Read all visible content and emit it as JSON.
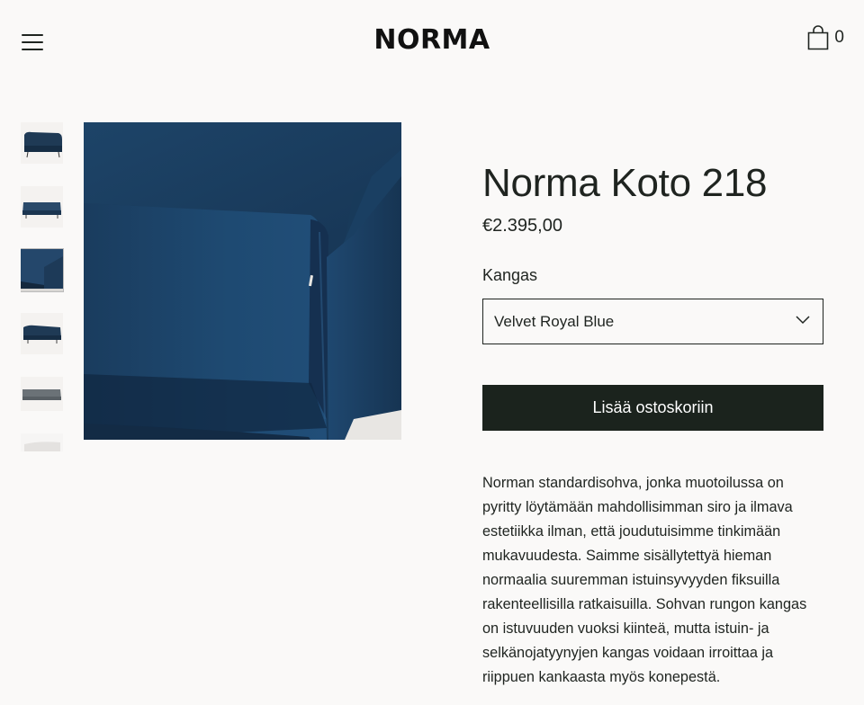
{
  "header": {
    "logo": "NORMA",
    "menu_icon": "hamburger-menu-icon",
    "cart_icon": "shopping-bag-icon",
    "cart_count": "0"
  },
  "gallery": {
    "thumbnails": [
      {
        "icon": "sofa-side-thumbnail"
      },
      {
        "icon": "sofa-front-thumbnail"
      },
      {
        "icon": "sofa-armrest-detail-thumbnail",
        "active": true
      },
      {
        "icon": "sofa-angle-thumbnail"
      },
      {
        "icon": "sofa-grey-thumbnail"
      },
      {
        "icon": "sofa-partial-thumbnail"
      }
    ],
    "main_image": "blue-velvet-sofa-armrest-detail"
  },
  "product": {
    "title": "Norma Koto 218",
    "price": "€2.395,00",
    "fabric_label": "Kangas",
    "fabric_value": "Velvet Royal Blue",
    "add_to_cart": "Lisää ostoskoriin",
    "description": "Norman standardisohva, jonka muotoilussa on pyritty löytämään mahdollisimman siro ja ilmava estetiikka ilman, että joudutuisimme tinkimään mukavuudesta. Saimme sisällytettyä hieman normaalia suuremman istuinsyvyyden fiksuilla rakenteellisilla ratkaisuilla. Sohvan rungon kangas on istuvuuden vuoksi kiinteä, mutta istuin- ja selkänojatyynyjen kangas voidaan irroittaa ja riippuen kankaasta myös konepestä."
  },
  "colors": {
    "background": "#faf9f8",
    "button": "#1b231d",
    "velvet": "#1d3f5f"
  }
}
